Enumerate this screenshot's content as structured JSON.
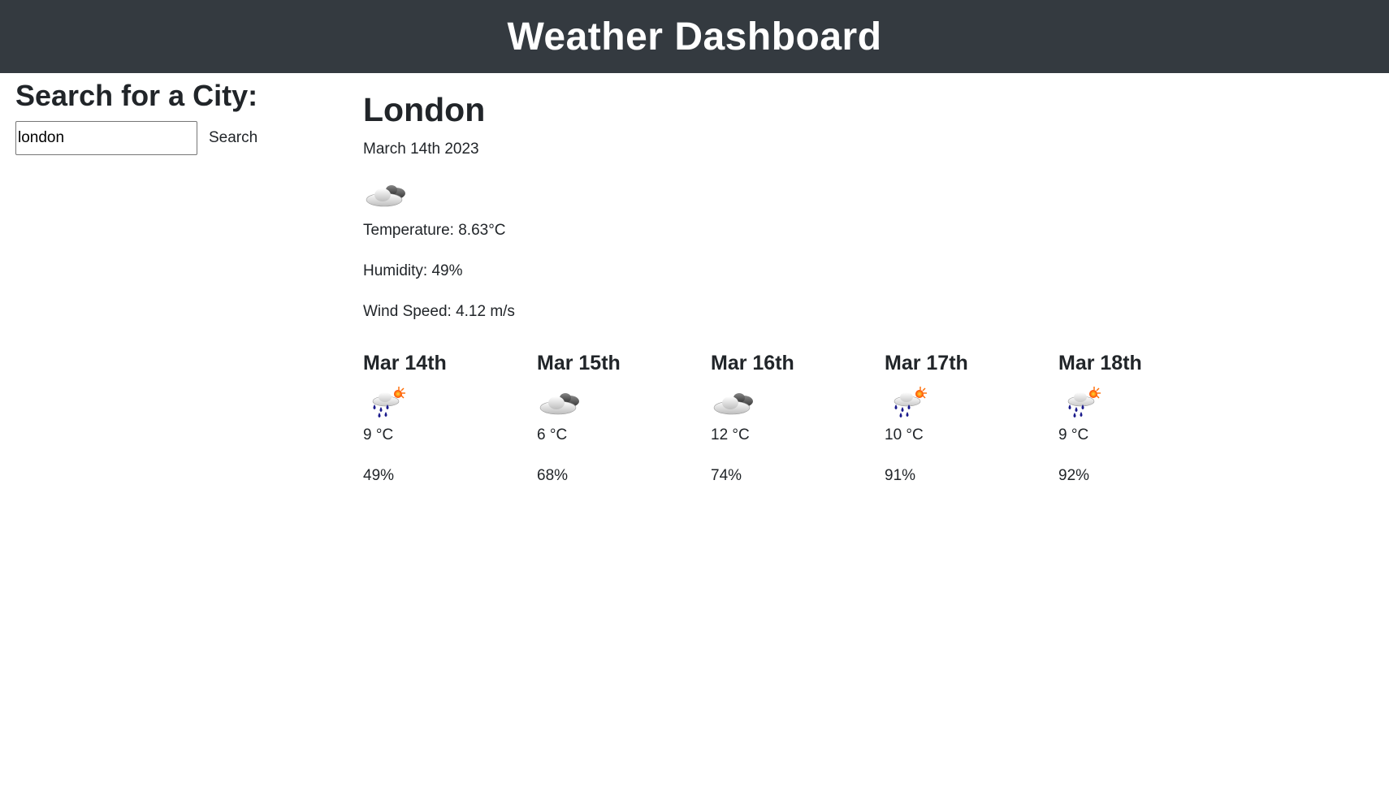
{
  "header": {
    "title": "Weather Dashboard"
  },
  "colors": {
    "header_bg": "#343a40",
    "header_text": "#ffffff",
    "body_text": "#212529"
  },
  "search": {
    "heading": "Search for a City:",
    "input_value": "london",
    "button_label": "Search"
  },
  "current": {
    "city": "London",
    "date": "March 14th 2023",
    "icon": "cloudy-icon",
    "temperature": "Temperature: 8.63°C",
    "humidity": "Humidity: 49%",
    "wind": "Wind Speed: 4.12 m/s"
  },
  "forecast": [
    {
      "date": "Mar 14th",
      "icon": "rain-sun-icon",
      "temp": "9 °C",
      "humidity": "49%"
    },
    {
      "date": "Mar 15th",
      "icon": "cloudy-icon",
      "temp": "6 °C",
      "humidity": "68%"
    },
    {
      "date": "Mar 16th",
      "icon": "cloudy-icon",
      "temp": "12 °C",
      "humidity": "74%"
    },
    {
      "date": "Mar 17th",
      "icon": "rain-sun-icon",
      "temp": "10 °C",
      "humidity": "91%"
    },
    {
      "date": "Mar 18th",
      "icon": "rain-sun-icon",
      "temp": "9 °C",
      "humidity": "92%"
    }
  ]
}
